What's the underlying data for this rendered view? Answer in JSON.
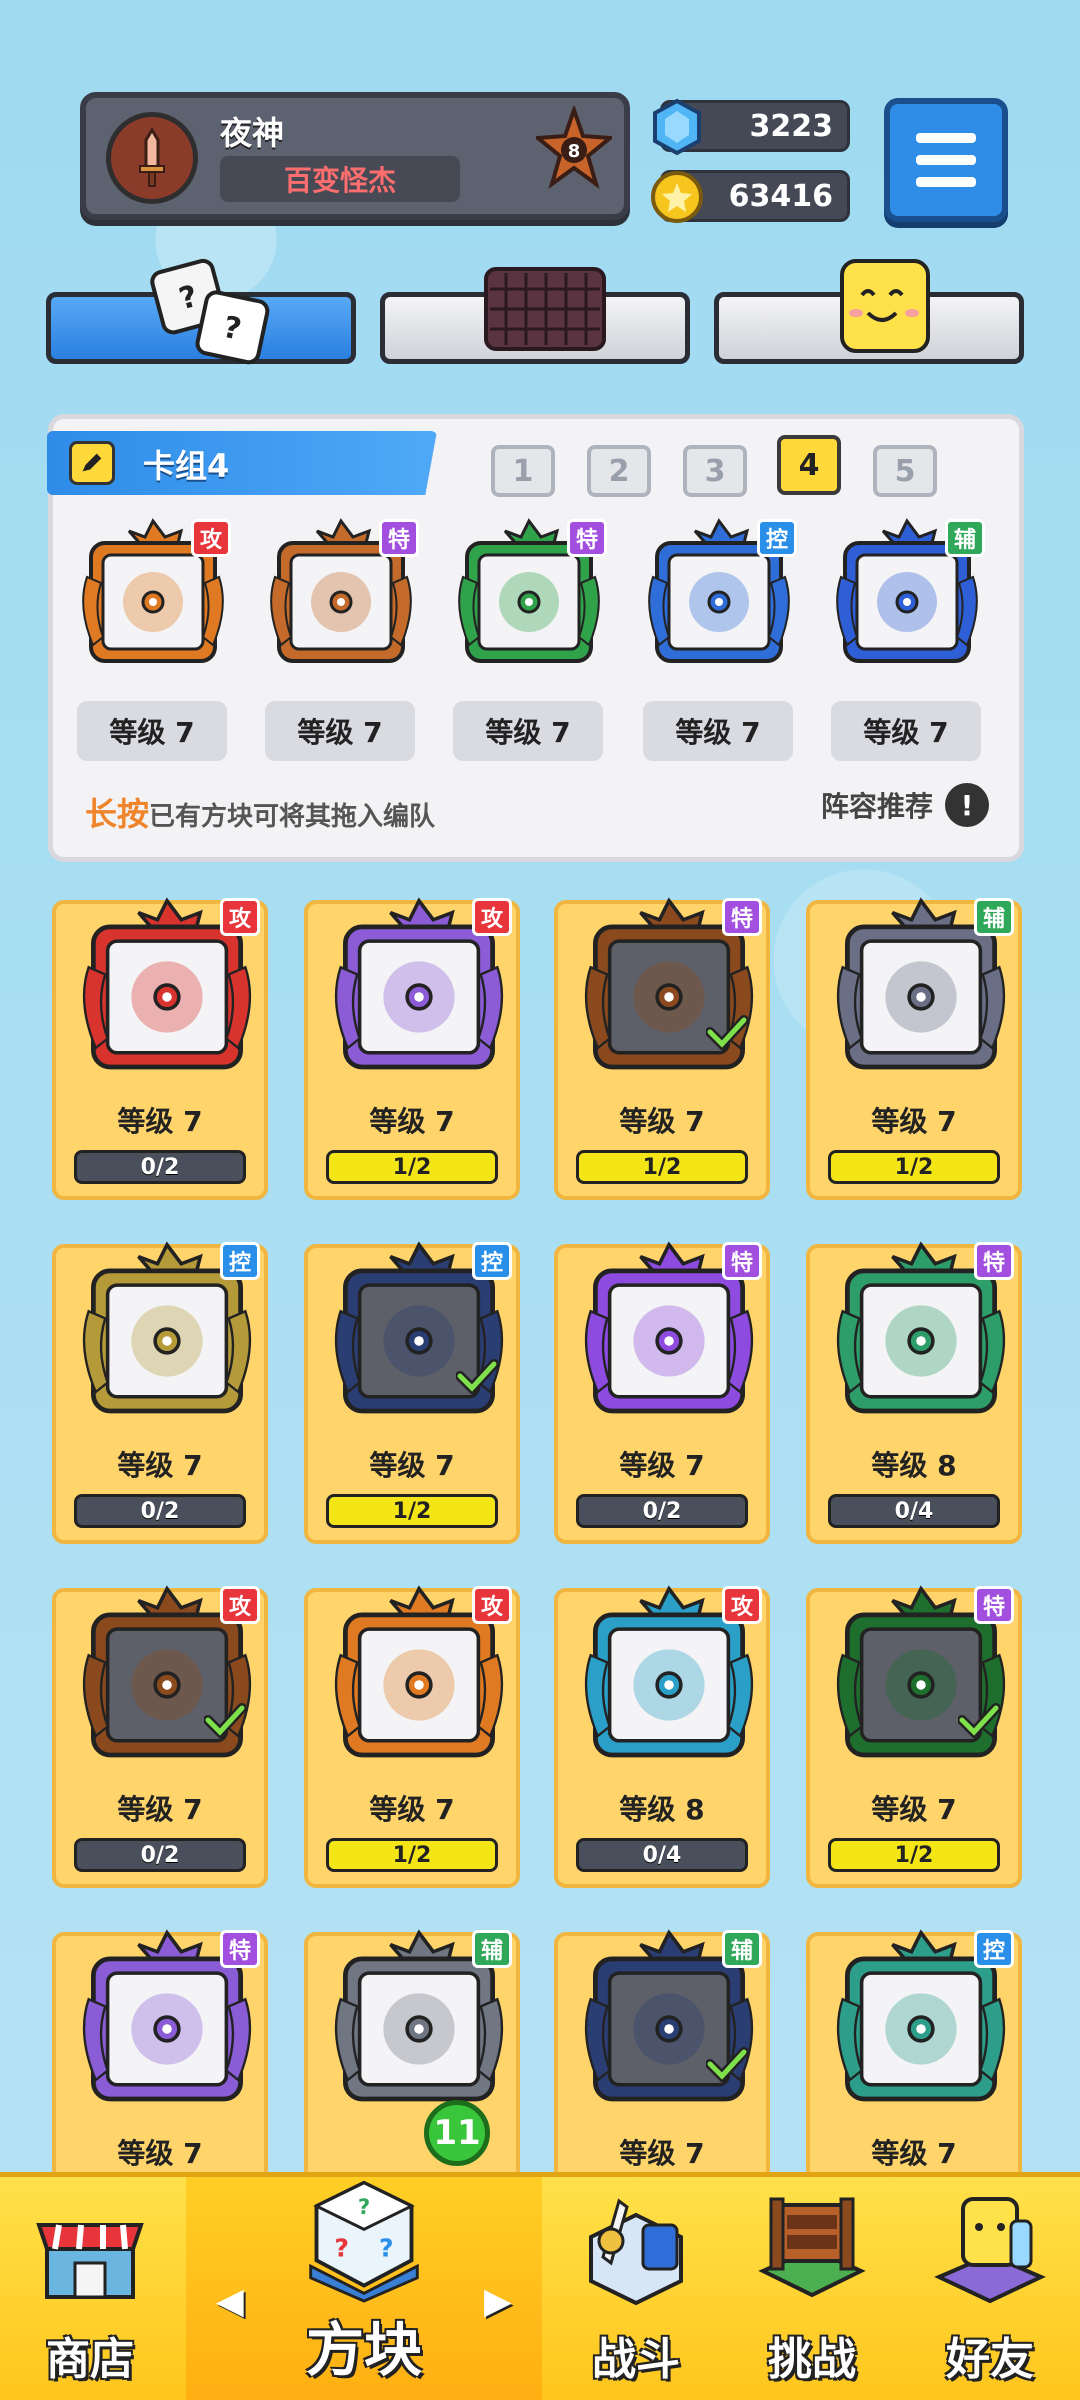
{
  "profile": {
    "name": "夜神",
    "title": "百变怪杰",
    "rank": "8"
  },
  "currency": {
    "gems": "3223",
    "coins": "63416"
  },
  "deck": {
    "title": "卡组4",
    "tabs": [
      "1",
      "2",
      "3",
      "4",
      "5"
    ],
    "active_tab": "4",
    "cards": [
      {
        "tag": "攻",
        "tag_type": "attack",
        "level": "等级 7",
        "color": "#e07a22",
        "icon": "sun-blade-icon"
      },
      {
        "tag": "特",
        "tag_type": "special",
        "level": "等级 7",
        "color": "#c46a2a",
        "icon": "infinity-icon"
      },
      {
        "tag": "特",
        "tag_type": "special",
        "level": "等级 7",
        "color": "#2fa24a",
        "icon": "leaf-icon"
      },
      {
        "tag": "控",
        "tag_type": "control",
        "level": "等级 7",
        "color": "#2f6ed8",
        "icon": "snowflake-icon"
      },
      {
        "tag": "辅",
        "tag_type": "support",
        "level": "等级 7",
        "color": "#2f5fd6",
        "icon": "moon-icon"
      }
    ],
    "hint_accent": "长按",
    "hint_text": "已有方块可将其拖入编队",
    "lineup_label": "阵容推荐",
    "lineup_icon": "!"
  },
  "collection": [
    {
      "tag": "攻",
      "tag_type": "attack",
      "level": "等级 7",
      "progress": "0/2",
      "fill": 0,
      "color": "#d9332e",
      "checked": false
    },
    {
      "tag": "攻",
      "tag_type": "attack",
      "level": "等级 7",
      "progress": "1/2",
      "fill": 1,
      "color": "#8b5cd6",
      "checked": false
    },
    {
      "tag": "特",
      "tag_type": "special",
      "level": "等级 7",
      "progress": "1/2",
      "fill": 1,
      "color": "#8a4a1e",
      "checked": true
    },
    {
      "tag": "辅",
      "tag_type": "support",
      "level": "等级 7",
      "progress": "1/2",
      "fill": 1,
      "color": "#6a6f86",
      "checked": false
    },
    {
      "tag": "控",
      "tag_type": "control",
      "level": "等级 7",
      "progress": "0/2",
      "fill": 0,
      "color": "#b59a3a",
      "checked": false
    },
    {
      "tag": "控",
      "tag_type": "control",
      "level": "等级 7",
      "progress": "1/2",
      "fill": 1,
      "color": "#2b3e74",
      "checked": true
    },
    {
      "tag": "特",
      "tag_type": "special",
      "level": "等级 7",
      "progress": "0/2",
      "fill": 0,
      "color": "#8e4be0",
      "checked": false
    },
    {
      "tag": "特",
      "tag_type": "special",
      "level": "等级 8",
      "progress": "0/4",
      "fill": 0,
      "color": "#2d9e6a",
      "checked": false
    },
    {
      "tag": "攻",
      "tag_type": "attack",
      "level": "等级 7",
      "progress": "0/2",
      "fill": 0,
      "color": "#8a4a1e",
      "checked": true
    },
    {
      "tag": "攻",
      "tag_type": "attack",
      "level": "等级 7",
      "progress": "1/2",
      "fill": 1,
      "color": "#e07a22",
      "checked": false
    },
    {
      "tag": "攻",
      "tag_type": "attack",
      "level": "等级 8",
      "progress": "0/4",
      "fill": 0,
      "color": "#2aa0c8",
      "checked": false
    },
    {
      "tag": "特",
      "tag_type": "special",
      "level": "等级 7",
      "progress": "1/2",
      "fill": 1,
      "color": "#1e6e2e",
      "checked": true
    },
    {
      "tag": "特",
      "tag_type": "special",
      "level": "等级 7",
      "progress": "",
      "fill": 0,
      "color": "#8a5cd6",
      "checked": false
    },
    {
      "tag": "辅",
      "tag_type": "support",
      "level": "",
      "progress": "",
      "fill": 0,
      "color": "#707682",
      "checked": false
    },
    {
      "tag": "辅",
      "tag_type": "support",
      "level": "等级 7",
      "progress": "",
      "fill": 0,
      "color": "#2b3e74",
      "checked": true
    },
    {
      "tag": "控",
      "tag_type": "control",
      "level": "等级 7",
      "progress": "",
      "fill": 0,
      "color": "#2d9e8a",
      "checked": false
    }
  ],
  "nav": {
    "shop": "商店",
    "blocks": "方块",
    "battle": "战斗",
    "challenge": "挑战",
    "friends": "好友",
    "blocks_badge": "11"
  }
}
